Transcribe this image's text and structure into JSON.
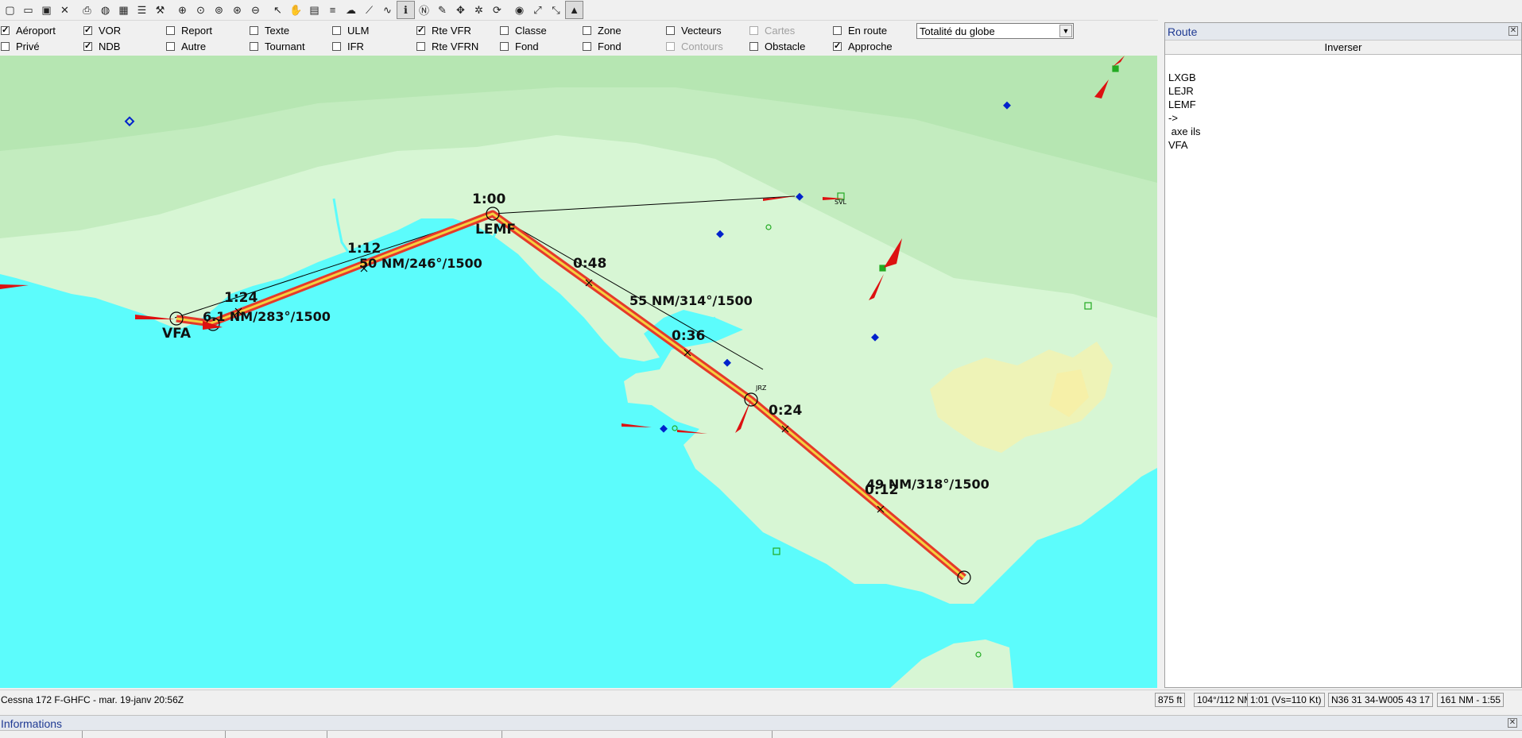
{
  "toolbar": {
    "buttons": [
      "new-file-icon",
      "open-folder-icon",
      "save-icon",
      "close-icon",
      "print-icon",
      "globe-icon",
      "table-icon",
      "list-icon",
      "tools-icon",
      "zoom-in-icon",
      "zoom-fit-icon",
      "zoom-reset-icon",
      "zoom-window-icon",
      "zoom-out-icon",
      "pointer-icon",
      "hand-pan-icon",
      "flight-log-icon",
      "route-list-icon",
      "weather-icon",
      "profile-icon",
      "chart-icon",
      "info-icon",
      "notam-icon",
      "pencil-icon",
      "move-icon",
      "settings-icon",
      "refresh-icon",
      "color-wheel-icon",
      "expand-icon",
      "measure-icon",
      "terrain-icon"
    ]
  },
  "layers": {
    "row1": [
      {
        "label": "Aéroport",
        "checked": true
      },
      {
        "label": "VOR",
        "checked": true
      },
      {
        "label": "Report",
        "checked": false
      },
      {
        "label": "Texte",
        "checked": false
      },
      {
        "label": "ULM",
        "checked": false
      },
      {
        "label": "Rte VFR",
        "checked": true
      },
      {
        "label": "Classe",
        "checked": false
      },
      {
        "label": "Zone",
        "checked": false
      },
      {
        "label": "Vecteurs",
        "checked": false
      },
      {
        "label": "Cartes",
        "checked": false,
        "disabled": true
      },
      {
        "label": "En route",
        "checked": false
      }
    ],
    "row2": [
      {
        "label": "Privé",
        "checked": false
      },
      {
        "label": "NDB",
        "checked": true
      },
      {
        "label": "Autre",
        "checked": false
      },
      {
        "label": "Tournant",
        "checked": false
      },
      {
        "label": "IFR",
        "checked": false
      },
      {
        "label": "Rte VFRN",
        "checked": false
      },
      {
        "label": "Fond",
        "checked": false
      },
      {
        "label": "Fond",
        "checked": false
      },
      {
        "label": "Contours",
        "checked": false,
        "disabled": true
      },
      {
        "label": "Obstacle",
        "checked": false
      },
      {
        "label": "Approche",
        "checked": true
      }
    ],
    "region_select": "Totalité du globe"
  },
  "map": {
    "waypoints": [
      {
        "name": "LEMF",
        "time": "1:00"
      },
      {
        "name": "VFA",
        "time": ""
      }
    ],
    "time_marks": [
      "1:24",
      "1:12",
      "0:48",
      "0:36",
      "0:24",
      "0:12"
    ],
    "leg_labels": [
      "6.1 NM/283°/1500",
      "50 NM/246°/1500",
      "55 NM/314°/1500",
      "49 NM/318°/1500"
    ],
    "navaid_labels": [
      "SVL",
      "JRZ"
    ],
    "colors": {
      "sea": "#5cfcfc",
      "land": "#d7f6d4",
      "route": "#e53a2a",
      "route_core": "#f4d03f",
      "navaid": "#0022cc"
    }
  },
  "route_panel": {
    "title": "Route",
    "invert_button": "Inverser",
    "items": [
      "LXGB",
      "LEJR",
      "LEMF",
      "->",
      " axe ils",
      "VFA"
    ]
  },
  "status": {
    "left": "Cessna 172 F-GHFC - mar. 19-janv 20:56Z",
    "cells": [
      "875 ft",
      "104°/112 NM",
      "1:01 (Vs=110 Kt)",
      "N36 31 34-W005 43 17",
      "161 NM - 1:55"
    ]
  },
  "info_panel": {
    "title": "Informations"
  }
}
